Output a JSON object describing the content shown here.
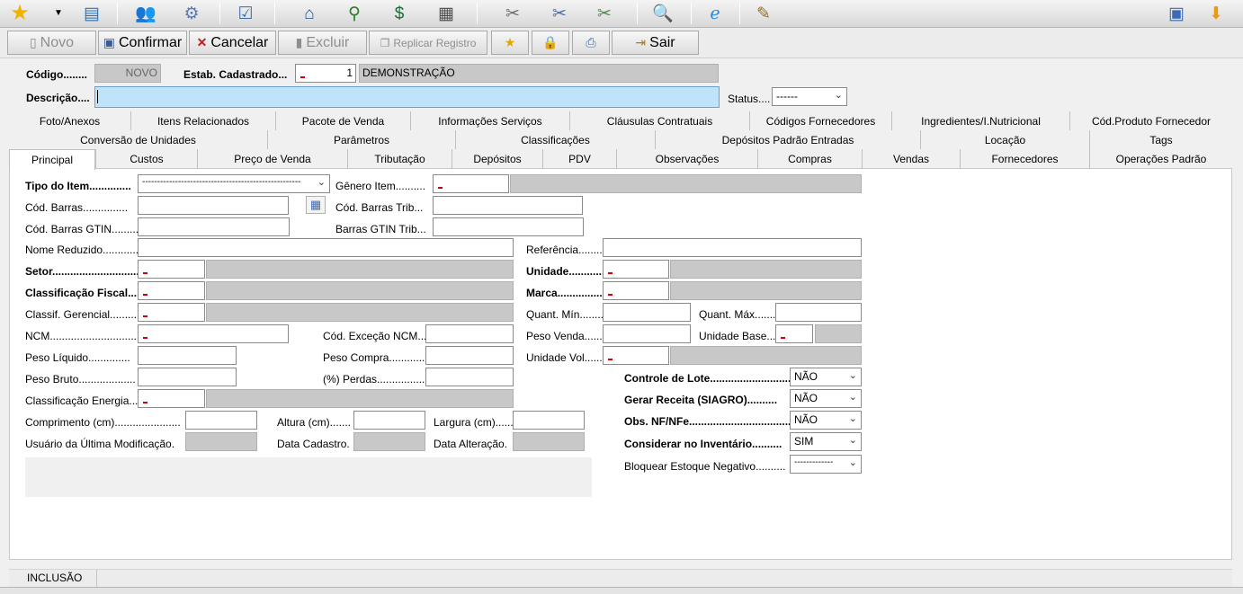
{
  "toolbar": {
    "icons": [
      "star-icon",
      "dropdown-arrow-icon",
      "notepad-icon",
      "users-icon",
      "cd-settings-icon",
      "checklist-icon",
      "house-icon",
      "search-tree-icon",
      "money-book-icon",
      "calculator-icon",
      "tools-config-icon",
      "tools-config-2-icon",
      "tools-config-3-icon",
      "magnifier-icon",
      "internet-explorer-icon",
      "document-seal-icon",
      "window-layout-icon",
      "download-arrow-icon"
    ]
  },
  "actions": {
    "novo": "Novo",
    "confirmar": "Confirmar",
    "cancelar": "Cancelar",
    "excluir": "Excluir",
    "replicar": "Replicar Registro",
    "sair": "Sair"
  },
  "header": {
    "codigo_label": "Código........",
    "codigo_value": "NOVO",
    "estab_label": "Estab. Cadastrado...",
    "estab_code": "1",
    "estab_name": "DEMONSTRAÇÃO",
    "descricao_label": "Descrição....",
    "descricao_value": "",
    "status_label": "Status....",
    "status_value": "------"
  },
  "tabs": {
    "row1": [
      "Foto/Anexos",
      "Itens Relacionados",
      "Pacote de Venda",
      "Informações Serviços",
      "Cláusulas Contratuais",
      "Códigos Fornecedores",
      "Ingredientes/I.Nutricional",
      "Cód.Produto Fornecedor"
    ],
    "row2": [
      "Conversão de Unidades",
      "Parâmetros",
      "Classificações",
      "Depósitos Padrão Entradas",
      "Locação",
      "Tags"
    ],
    "row3": [
      "Principal",
      "Custos",
      "Preço de Venda",
      "Tributação",
      "Depósitos",
      "PDV",
      "Observações",
      "Compras",
      "Vendas",
      "Fornecedores",
      "Operações Padrão"
    ]
  },
  "form": {
    "tipo_item_label": "Tipo do Item..............",
    "tipo_item_value": "-----------------------------------------------------",
    "genero_label": "Gênero Item..........",
    "cod_barras_label": "Cód. Barras...............",
    "cod_barras_trib_label": "Cód. Barras Trib...",
    "cod_barras_gtin_label": "Cód. Barras GTIN.........",
    "barras_gtin_trib_label": "Barras GTIN Trib...",
    "nome_reduzido_label": "Nome Reduzido............",
    "referencia_label": "Referência.............",
    "setor_label": "Setor.......................................",
    "unidade_label": "Unidade........................",
    "class_fiscal_label": "Classificação Fiscal...........",
    "marca_label": "Marca............................",
    "class_gerencial_label": "Classif. Gerencial.............",
    "quant_min_label": "Quant. Mín...............",
    "quant_max_label": "Quant. Máx.............",
    "ncm_label": "NCM..........................................",
    "cod_excecao_ncm_label": "Cód. Exceção NCM.......",
    "peso_venda_label": "Peso Venda...............",
    "unidade_base_label": "Unidade Base...........",
    "peso_liquido_label": "Peso Líquido..............",
    "peso_compra_label": "Peso Compra..................",
    "unidade_vol_label": "Unidade Vol...............",
    "peso_bruto_label": "Peso Bruto...................",
    "perdas_label": "(%) Perdas....................",
    "class_energia_label": "Classificação Energia...",
    "comprimento_label": "Comprimento (cm)......................",
    "altura_label": "Altura (cm).......",
    "largura_label": "Largura (cm).......",
    "usuario_label": "Usuário da Última Modificação.",
    "data_cadastro_label": "Data Cadastro.",
    "data_alteracao_label": "Data Alteração.",
    "controle_lote_label": "Controle de Lote...........................",
    "controle_lote_value": "NÃO",
    "gerar_receita_label": "Gerar Receita (SIAGRO)..........",
    "gerar_receita_value": "NÃO",
    "obs_nf_label": "Obs. NF/NFe......................................",
    "obs_nf_value": "NÃO",
    "considerar_inv_label": "Considerar no Inventário..........",
    "considerar_inv_value": "SIM",
    "bloquear_estoque_label": "Bloquear Estoque Negativo..........",
    "bloquear_estoque_value": "-------------"
  },
  "status": {
    "mode": "INCLUSÃO"
  }
}
